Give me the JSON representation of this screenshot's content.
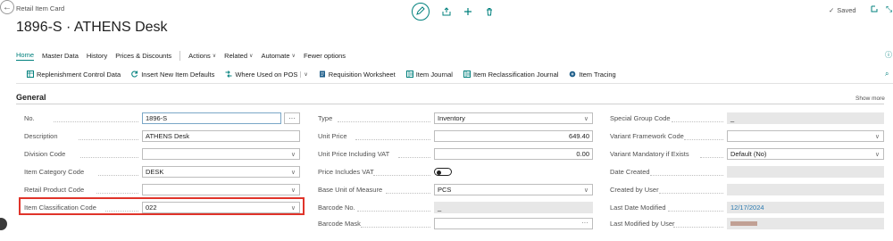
{
  "header": {
    "breadcrumb": "Retail Item Card",
    "title": "1896-S · ATHENS Desk",
    "saved_label": "Saved"
  },
  "tabs": [
    {
      "label": "Home"
    },
    {
      "label": "Master Data"
    },
    {
      "label": "History"
    },
    {
      "label": "Prices & Discounts"
    },
    {
      "label": "Actions"
    },
    {
      "label": "Related"
    },
    {
      "label": "Automate"
    },
    {
      "label": "Fewer options"
    }
  ],
  "toolbar": [
    {
      "label": "Replenishment Control Data",
      "icon": "calendar-grid-icon"
    },
    {
      "label": "Insert New Item Defaults",
      "icon": "refresh-icon"
    },
    {
      "label": "Where Used on POS",
      "icon": "shuffle-icon"
    },
    {
      "label": "Requisition Worksheet",
      "icon": "document-icon"
    },
    {
      "label": "Item Journal",
      "icon": "journal-icon"
    },
    {
      "label": "Item Reclassification Journal",
      "icon": "journal-icon"
    },
    {
      "label": "Item Tracing",
      "icon": "tracing-icon"
    }
  ],
  "section": {
    "title": "General",
    "show_more": "Show more"
  },
  "col1": [
    {
      "label": "No.",
      "value": "1896-S"
    },
    {
      "label": "Description",
      "value": "ATHENS Desk"
    },
    {
      "label": "Division Code",
      "value": ""
    },
    {
      "label": "Item Category Code",
      "value": "DESK"
    },
    {
      "label": "Retail Product Code",
      "value": ""
    },
    {
      "label": "Item Classification Code",
      "value": "022"
    }
  ],
  "col2": [
    {
      "label": "Type",
      "value": "Inventory"
    },
    {
      "label": "Unit Price",
      "value": "649.40"
    },
    {
      "label": "Unit Price Including VAT",
      "value": "0.00"
    },
    {
      "label": "Price Includes VAT",
      "value": ""
    },
    {
      "label": "Base Unit of Measure",
      "value": "PCS"
    },
    {
      "label": "Barcode No.",
      "value": "_"
    },
    {
      "label": "Barcode Mask",
      "value": ""
    }
  ],
  "col3": [
    {
      "label": "Special Group Code",
      "value": "_"
    },
    {
      "label": "Variant Framework Code",
      "value": ""
    },
    {
      "label": "Variant Mandatory if Exists",
      "value": "Default (No)"
    },
    {
      "label": "Date Created",
      "value": ""
    },
    {
      "label": "Created by User",
      "value": ""
    },
    {
      "label": "Last Date Modified",
      "value": "12/17/2024"
    },
    {
      "label": "Last Modified by User",
      "value": ""
    }
  ],
  "colors": {
    "accent": "#00807d",
    "highlight": "#e0342a"
  }
}
